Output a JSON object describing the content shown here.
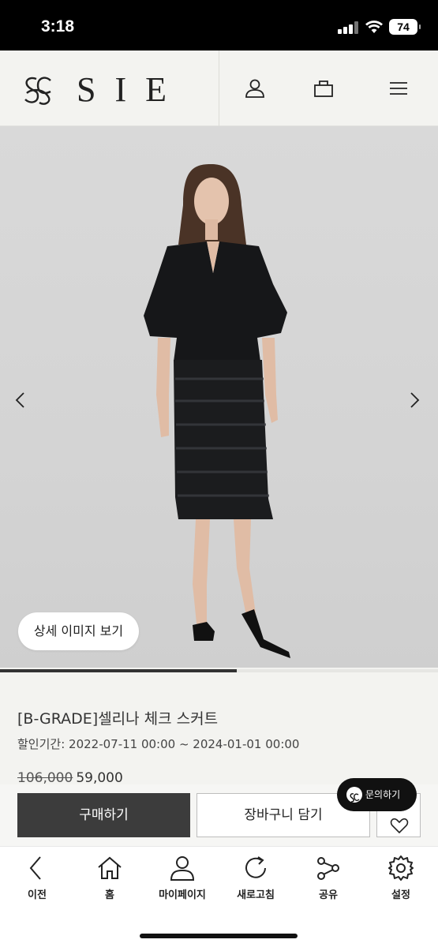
{
  "status_bar": {
    "time": "3:18",
    "battery": "74"
  },
  "header": {
    "brand": "SIE",
    "icons": [
      "user-icon",
      "bag-icon",
      "menu-icon"
    ]
  },
  "product": {
    "detail_image_button": "상세 이미지 보기",
    "gallery_progress": 0.54,
    "title": "[B-GRADE]셀리나 체크 스커트",
    "sale_period": "할인기간: 2022-07-11 00:00 ~ 2024-01-01 00:00",
    "original_price": "106,000",
    "sale_price": "59,000"
  },
  "inquiry_button": "문의하기",
  "actions": {
    "buy": "구매하기",
    "cart": "장바구니 담기"
  },
  "toolbar": {
    "items": [
      {
        "label": "이전",
        "icon": "back-icon"
      },
      {
        "label": "홈",
        "icon": "home-icon"
      },
      {
        "label": "마이페이지",
        "icon": "person-icon"
      },
      {
        "label": "새로고침",
        "icon": "refresh-icon"
      },
      {
        "label": "공유",
        "icon": "share-icon"
      },
      {
        "label": "설정",
        "icon": "gear-icon"
      }
    ]
  },
  "colors": {
    "buy_button": "#3c3c3c",
    "header_bg": "#f3f3f0",
    "image_bg": "#d6d6d6"
  }
}
